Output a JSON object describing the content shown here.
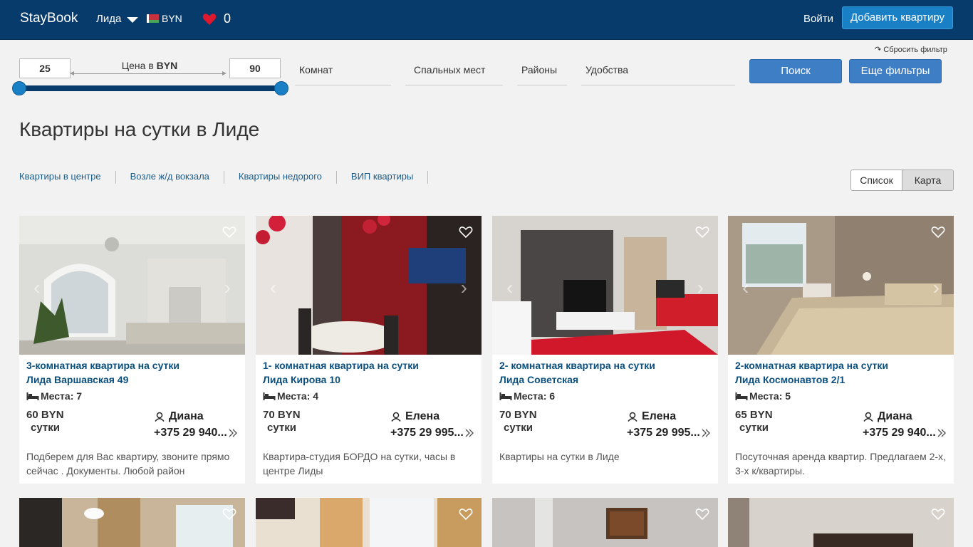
{
  "header": {
    "brand": "StayBook",
    "city": "Лида",
    "currency": "BYN",
    "favorites_count": "0",
    "login": "Войти",
    "add_apartment": "Добавить квартиру"
  },
  "filters": {
    "reset": "↷ Сбросить фильтр",
    "price_min": "25",
    "price_max": "90",
    "price_label_prefix": "Цена в",
    "price_label_currency": "BYN",
    "price_range_min_fraction": 0.0,
    "price_range_max_fraction": 1.0,
    "rooms": "Комнат",
    "beds": "Спальных мест",
    "districts": "Районы",
    "amenities": "Удобства",
    "search": "Поиск",
    "more_filters": "Еще фильтры"
  },
  "page_title": "Квартиры на сутки в Лиде",
  "quick_links": [
    "Квартиры в центре",
    "Возле ж/д вокзала",
    "Квартиры недорого",
    "ВИП квартиры"
  ],
  "view_toggle": {
    "list": "Список",
    "map": "Карта"
  },
  "colors": {
    "header_bg": "#073b6c",
    "accent": "#1a80c6",
    "title_link": "#0b4f7e"
  },
  "listings": [
    {
      "title": "3-комнатная квартира на сутки",
      "address": "Лида Варшавская 49",
      "places": "Места: 7",
      "price": "60 BYN",
      "unit": "сутки",
      "owner": "Диана",
      "phone": "+375 29 940...",
      "description": "Подберем для Вас квартиру, звоните прямо сейчас . Документы. Любой район"
    },
    {
      "title": "1- комнатная квартира на сутки",
      "address": "Лида Кирова 10",
      "places": "Места: 4",
      "price": "70 BYN",
      "unit": "сутки",
      "owner": "Елена",
      "phone": "+375 29 995...",
      "description": "Квартира-студия БОРДО на сутки, часы в центре Лиды"
    },
    {
      "title": "2- комнатная квартира на сутки",
      "address": "Лида Советская",
      "places": "Места: 6",
      "price": "70 BYN",
      "unit": "сутки",
      "owner": "Елена",
      "phone": "+375 29 995...",
      "description": "Квартиры на сутки в Лиде"
    },
    {
      "title": "2-комнатная квартира на сутки",
      "address": "Лида Космонавтов 2/1",
      "places": "Места: 5",
      "price": "65 BYN",
      "unit": "сутки",
      "owner": "Диана",
      "phone": "+375 29 940...",
      "description": "Посуточная аренда квартир. Предлагаем 2-х, 3-х к/квартиры."
    }
  ]
}
